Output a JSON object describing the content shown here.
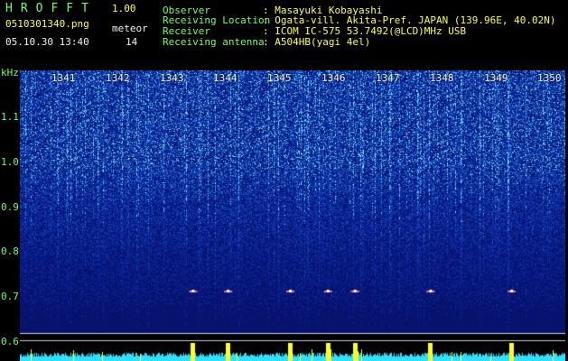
{
  "header": {
    "app_title": "HROFFT",
    "app_version": "1.00",
    "file_name": "0510301340.png",
    "meteor_label": "meteor",
    "date_time": "05.10.30 13:40",
    "meteor_count": "14"
  },
  "info": [
    {
      "label": "Observer",
      "value": ": Masayuki Kobayashi"
    },
    {
      "label": "Receiving Location",
      "value": ": Ogata-vill. Akita-Pref. JAPAN (139.96E, 40.02N)"
    },
    {
      "label": "Receiver",
      "value": ": ICOM IC-575 53.7492(@LCD)MHz USB"
    },
    {
      "label": "Receiving antenna",
      "value": ": A504HB(yagi 4el)"
    }
  ],
  "axis": {
    "unit": "kHz",
    "freq_ticks": [
      "1.1",
      "1.0",
      "0.9",
      "0.8",
      "0.7",
      "0.6"
    ],
    "minute_ticks": [
      "1341",
      "1342",
      "1343",
      "1344",
      "1345",
      "1346",
      "1347",
      "1348",
      "1349",
      "1350"
    ]
  },
  "colors": {
    "background": "#000000",
    "header_label": "#6cff6c",
    "header_value": "#ffff40",
    "spectrum_bg": "#0a1a8a",
    "noise_trace": "#30e0ff",
    "meteor_peak": "#ffff20"
  },
  "meteor_events_minutes": [
    1343.6,
    1344.25,
    1345.4,
    1346.1,
    1346.6,
    1348.0,
    1349.5
  ]
}
